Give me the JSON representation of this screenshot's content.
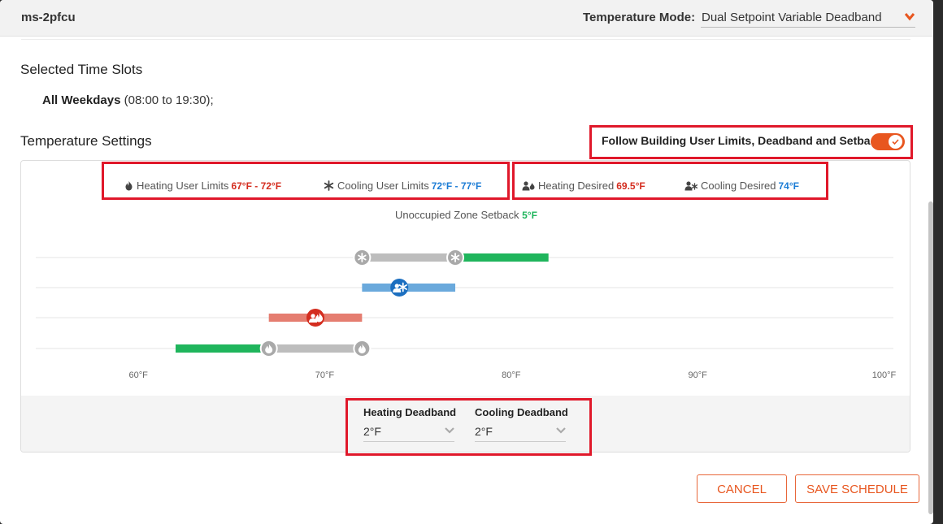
{
  "header": {
    "title": "ms-2pfcu",
    "temperature_mode_label": "Temperature Mode:",
    "temperature_mode_value": "Dual Setpoint Variable Deadband"
  },
  "time_slots": {
    "heading": "Selected Time Slots",
    "entry_name": "All Weekdays",
    "entry_range": " (08:00 to 19:30);"
  },
  "temperature_settings": {
    "heading": "Temperature Settings",
    "follow_label": "Follow Building User Limits, Deadband and Setback",
    "follow_enabled": true
  },
  "legend": {
    "heating_limits_label": "Heating User Limits",
    "heating_limits_value": "67°F - 72°F",
    "cooling_limits_label": "Cooling User Limits",
    "cooling_limits_value": "72°F - 77°F",
    "heating_desired_label": "Heating Desired",
    "heating_desired_value": "69.5°F",
    "cooling_desired_label": "Cooling Desired",
    "cooling_desired_value": "74°F",
    "setback_label": "Unoccupied Zone Setback",
    "setback_value": "5°F"
  },
  "chart_data": {
    "type": "range-track",
    "x_ticks": [
      "60°F",
      "70°F",
      "80°F",
      "90°F",
      "100°F"
    ],
    "x_tick_values": [
      60,
      70,
      80,
      90,
      100
    ],
    "x_range": [
      54.5,
      100.5
    ],
    "rows": [
      {
        "kind": "cooling-limits",
        "range": [
          72,
          77
        ],
        "setback_to": 82,
        "handle_icons": [
          "snowflake",
          "snowflake"
        ]
      },
      {
        "kind": "cooling-desired",
        "range": [
          72,
          77
        ],
        "value": 74
      },
      {
        "kind": "heating-desired",
        "range": [
          67,
          72
        ],
        "value": 69.5
      },
      {
        "kind": "heating-limits",
        "range": [
          67,
          72
        ],
        "setback_from": 62,
        "handle_icons": [
          "flame",
          "flame"
        ]
      }
    ],
    "colors": {
      "limit_bar": "#bdbdbd",
      "setback": "#1fb55c",
      "cooling": "#6aa9dc",
      "cooling_knob": "#1c6fc0",
      "heating": "#e57d70",
      "heating_knob": "#d42d1f",
      "track": "#e6e6e6"
    }
  },
  "deadband": {
    "heating_label": "Heating Deadband",
    "heating_value": "2°F",
    "cooling_label": "Cooling Deadband",
    "cooling_value": "2°F"
  },
  "actions": {
    "cancel": "CANCEL",
    "save": "SAVE SCHEDULE"
  },
  "colors": {
    "accent": "#e8561f",
    "highlight_box": "#e0182a",
    "heating": "#d42d1f",
    "cooling": "#1c7cd5",
    "setback": "#1fb55c"
  }
}
